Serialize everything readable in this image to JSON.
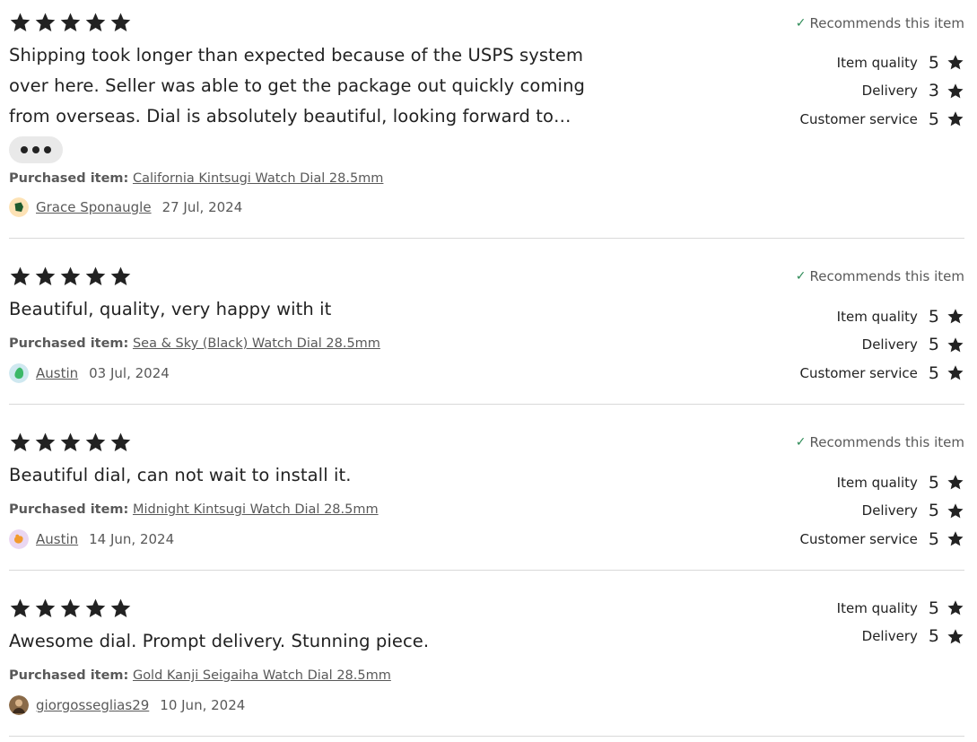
{
  "reviews": [
    {
      "rating": 5,
      "recommends": "Recommends this item",
      "text": "Shipping took longer than expected because of the USPS system over here. Seller was able to get the package out quickly coming from overseas. Dial is absolutely beautiful, looking forward to…",
      "purchased_label": "Purchased item:",
      "item": "California Kintsugi Watch Dial 28.5mm",
      "reviewer": "Grace Sponaugle",
      "date": "27 Jul, 2024",
      "avatar_bg": "#fde2b5",
      "avatar_fg": "#1e5a2e",
      "ratings": [
        {
          "label": "Item quality",
          "value": "5"
        },
        {
          "label": "Delivery",
          "value": "3"
        },
        {
          "label": "Customer service",
          "value": "5"
        }
      ]
    },
    {
      "rating": 5,
      "recommends": "Recommends this item",
      "text": "Beautiful, quality, very happy with it",
      "purchased_label": "Purchased item:",
      "item": "Sea & Sky (Black) Watch Dial 28.5mm",
      "reviewer": "Austin",
      "date": "03 Jul, 2024",
      "avatar_bg": "#cfe8f0",
      "avatar_fg": "#3cb868",
      "ratings": [
        {
          "label": "Item quality",
          "value": "5"
        },
        {
          "label": "Delivery",
          "value": "5"
        },
        {
          "label": "Customer service",
          "value": "5"
        }
      ]
    },
    {
      "rating": 5,
      "recommends": "Recommends this item",
      "text": "Beautiful dial, can not wait to install it.",
      "purchased_label": "Purchased item:",
      "item": "Midnight Kintsugi Watch Dial 28.5mm",
      "reviewer": "Austin",
      "date": "14 Jun, 2024",
      "avatar_bg": "#ead7f2",
      "avatar_fg": "#f29a2e",
      "ratings": [
        {
          "label": "Item quality",
          "value": "5"
        },
        {
          "label": "Delivery",
          "value": "5"
        },
        {
          "label": "Customer service",
          "value": "5"
        }
      ]
    },
    {
      "rating": 5,
      "text": "Awesome dial. Prompt delivery. Stunning piece.",
      "purchased_label": "Purchased item:",
      "item": "Gold Kanji Seigaiha Watch Dial 28.5mm",
      "reviewer": "giorgosseglias29",
      "date": "10 Jun, 2024",
      "avatar_bg": "#8a6a48",
      "avatar_fg": "#d9b48a",
      "ratings": [
        {
          "label": "Item quality",
          "value": "5"
        },
        {
          "label": "Delivery",
          "value": "5"
        }
      ]
    }
  ],
  "colors": {
    "text": "#222222",
    "muted": "#595959",
    "check": "#2e8b57",
    "divider": "#d9d9d9",
    "more_button_bg": "#e9e9e9"
  },
  "icons": {
    "star": "star-icon",
    "check": "check-icon",
    "more": "more-dots-icon"
  }
}
